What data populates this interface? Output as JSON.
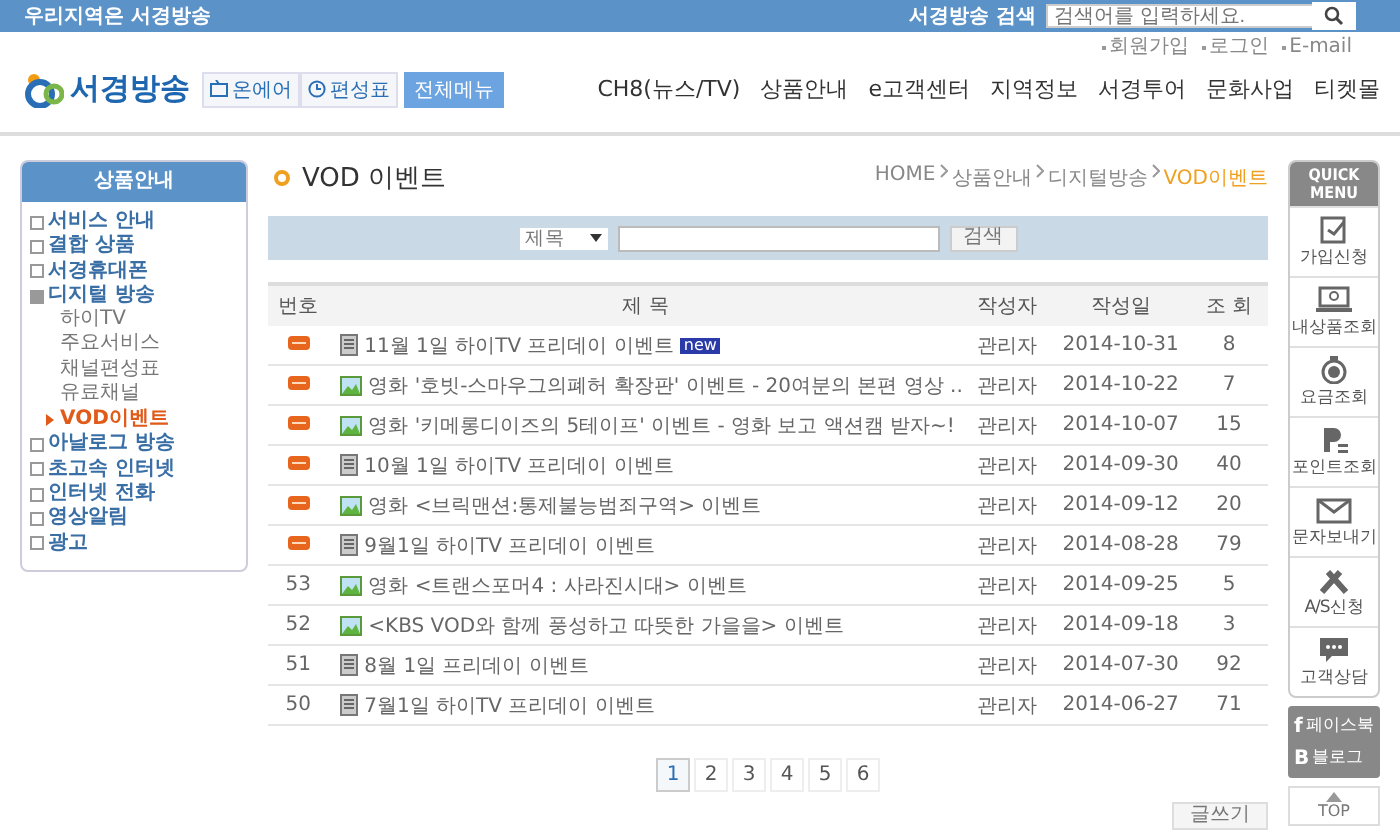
{
  "topbar": {
    "tagline": "우리지역은 서경방송",
    "search_label": "서경방송 검색",
    "search": {
      "placeholder": "검색어를 입력하세요."
    }
  },
  "util_links": [
    "회원가입",
    "로그인",
    "E-mail"
  ],
  "header": {
    "logo": "서경방송",
    "quick_buttons": [
      {
        "label": "온에어",
        "kind": "tv"
      },
      {
        "label": "편성표",
        "kind": "clock"
      }
    ],
    "all_menu": "전체메뉴",
    "nav": [
      "CH8(뉴스/TV)",
      "상품안내",
      "e고객센터",
      "지역정보",
      "서경투어",
      "문화사업",
      "티켓몰"
    ]
  },
  "sidebar": {
    "title": "상품안내",
    "items": [
      {
        "label": "서비스 안내",
        "expanded": false
      },
      {
        "label": "결합 상품",
        "expanded": false
      },
      {
        "label": "서경휴대폰",
        "expanded": false
      },
      {
        "label": "디지털 방송",
        "expanded": true,
        "children": [
          {
            "label": "하이TV",
            "selected": false
          },
          {
            "label": "주요서비스",
            "selected": false
          },
          {
            "label": "채널편성표",
            "selected": false
          },
          {
            "label": "유료채널",
            "selected": false
          },
          {
            "label": "VOD이벤트",
            "selected": true
          }
        ]
      },
      {
        "label": "아날로그 방송",
        "expanded": false
      },
      {
        "label": "초고속 인터넷",
        "expanded": false
      },
      {
        "label": "인터넷 전화",
        "expanded": false
      },
      {
        "label": "영상알림",
        "expanded": false
      },
      {
        "label": "광고",
        "expanded": false
      }
    ]
  },
  "page": {
    "title": "VOD 이벤트",
    "breadcrumb": [
      "HOME",
      "상품안내",
      "디지털방송",
      "VOD이벤트"
    ]
  },
  "search_form": {
    "field": "제목",
    "button": "검색"
  },
  "table": {
    "columns": [
      "번호",
      "제 목",
      "작성자",
      "작성일",
      "조 회"
    ],
    "rows": [
      {
        "kind": "notice",
        "has_image": false,
        "title": "11월 1일 하이TV 프리데이 이벤트",
        "new_tag": "new",
        "author": "관리자",
        "date": "2014-10-31",
        "views": "8"
      },
      {
        "kind": "notice",
        "has_image": true,
        "title": "영화 '호빗-스마우그의폐허 확장판' 이벤트 - 20여분의 본편 영상 ..",
        "author": "관리자",
        "date": "2014-10-22",
        "views": "7"
      },
      {
        "kind": "notice",
        "has_image": true,
        "title": "영화 '키메롱디이즈의 5테이프' 이벤트 - 영화 보고 액션캠 받자~!",
        "author": "관리자",
        "date": "2014-10-07",
        "views": "15"
      },
      {
        "kind": "notice",
        "has_image": false,
        "title": "10월 1일 하이TV 프리데이 이벤트",
        "author": "관리자",
        "date": "2014-09-30",
        "views": "40"
      },
      {
        "kind": "notice",
        "has_image": true,
        "title": "영화 <브릭맨션:통제불능범죄구역> 이벤트",
        "author": "관리자",
        "date": "2014-09-12",
        "views": "20"
      },
      {
        "kind": "notice",
        "has_image": false,
        "title": "9월1일 하이TV 프리데이 이벤트",
        "author": "관리자",
        "date": "2014-08-28",
        "views": "79"
      },
      {
        "kind": "number",
        "no": "53",
        "has_image": true,
        "title": "영화 <트랜스포머4 : 사라진시대> 이벤트",
        "author": "관리자",
        "date": "2014-09-25",
        "views": "5"
      },
      {
        "kind": "number",
        "no": "52",
        "has_image": true,
        "title": "<KBS VOD와 함께 풍성하고 따뜻한 가을을> 이벤트",
        "author": "관리자",
        "date": "2014-09-18",
        "views": "3"
      },
      {
        "kind": "number",
        "no": "51",
        "has_image": false,
        "title": "8월 1일 프리데이 이벤트",
        "author": "관리자",
        "date": "2014-07-30",
        "views": "92"
      },
      {
        "kind": "number",
        "no": "50",
        "has_image": false,
        "title": "7월1일 하이TV 프리데이 이벤트",
        "author": "관리자",
        "date": "2014-06-27",
        "views": "71"
      }
    ]
  },
  "pagination": [
    {
      "label": "1",
      "selected": true
    },
    {
      "label": "2",
      "selected": false
    },
    {
      "label": "3",
      "selected": false
    },
    {
      "label": "4",
      "selected": false
    },
    {
      "label": "5",
      "selected": false
    },
    {
      "label": "6",
      "selected": false
    }
  ],
  "write_button": "글쓰기",
  "quick_menu": {
    "title": "QUICK MENU",
    "items": [
      "가입신청",
      "내상품조회",
      "요금조회",
      "포인트조회",
      "문자보내기",
      "A/S신청",
      "고객상담"
    ],
    "social": [
      {
        "mark": "f",
        "label": "페이스북"
      },
      {
        "mark": "B",
        "label": "블로그"
      }
    ],
    "top": "TOP"
  }
}
